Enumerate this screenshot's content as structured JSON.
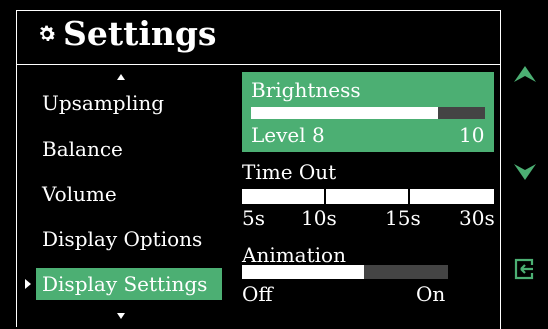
{
  "header": {
    "title": "Settings",
    "icon": "gear-icon"
  },
  "menu": {
    "items": [
      {
        "label": "Upsampling"
      },
      {
        "label": "Balance"
      },
      {
        "label": "Volume"
      },
      {
        "label": "Display Options"
      },
      {
        "label": "Display Settings",
        "selected": true
      }
    ]
  },
  "brightness": {
    "title": "Brightness",
    "level_label": "Level 8",
    "max_label": "10",
    "level": 8,
    "max": 10
  },
  "timeout": {
    "title": "Time Out",
    "options": [
      "5s",
      "10s",
      "15s",
      "30s"
    ]
  },
  "animation": {
    "title": "Animation",
    "off_label": "Off",
    "on_label": "On",
    "state": "off"
  },
  "side_buttons": {
    "up": "up-arrow-icon",
    "down": "down-arrow-icon",
    "back": "exit-icon"
  },
  "colors": {
    "accent": "#4caf73",
    "background": "#000000",
    "track": "#444444"
  }
}
